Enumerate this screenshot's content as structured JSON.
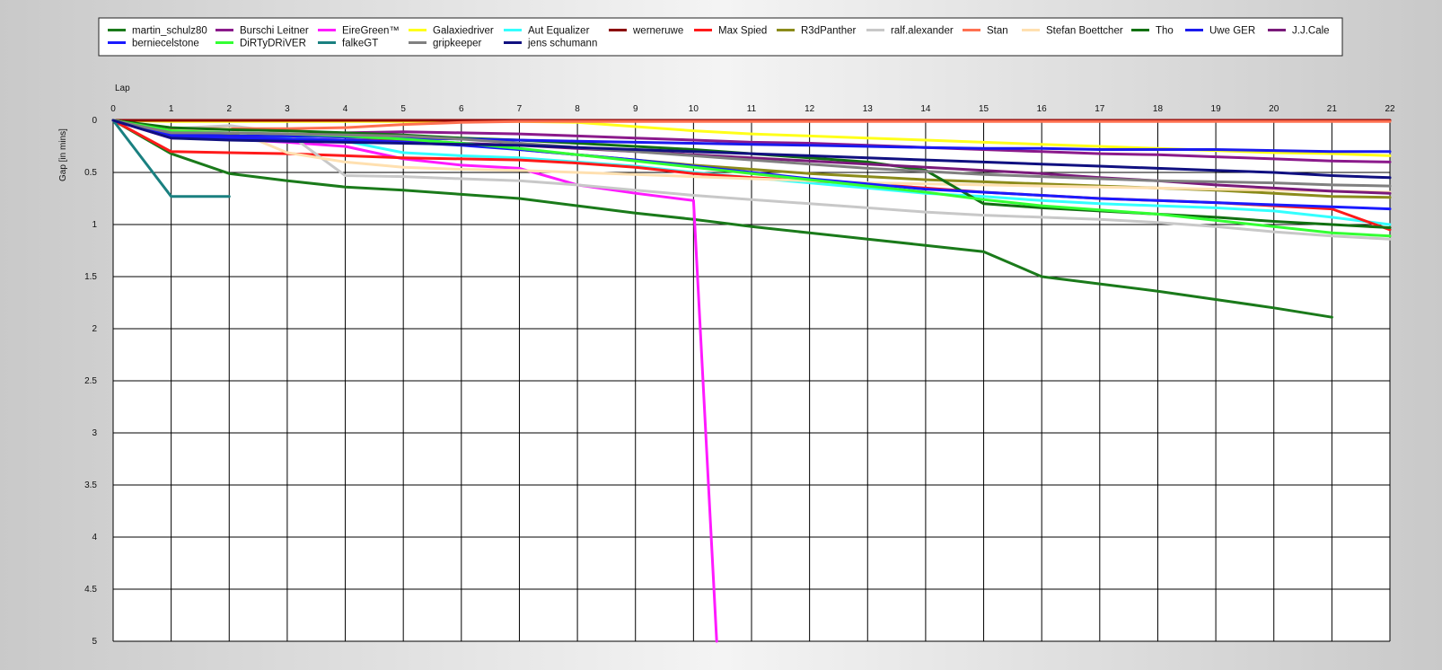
{
  "chart_data": {
    "type": "line",
    "title": "",
    "xlabel": "Lap",
    "ylabel": "Gap [in mins]",
    "xlim": [
      0,
      22
    ],
    "ylim": [
      0,
      5
    ],
    "y_inverted": true,
    "grid": true,
    "legend_position": "top",
    "x_ticks": [
      0,
      1,
      2,
      3,
      4,
      5,
      6,
      7,
      8,
      9,
      10,
      11,
      12,
      13,
      14,
      15,
      16,
      17,
      18,
      19,
      20,
      21,
      22
    ],
    "y_ticks": [
      0,
      0.5,
      1,
      1.5,
      2,
      2.5,
      3,
      3.5,
      4,
      4.5,
      5
    ],
    "series": [
      {
        "name": "martin_schulz80",
        "color": "#1a7a1a",
        "x": [
          0,
          1,
          2,
          3,
          4,
          5,
          6,
          7,
          8,
          9,
          10,
          11,
          12,
          13,
          14,
          15,
          16,
          17,
          18,
          19,
          20,
          21
        ],
        "y": [
          0,
          0.32,
          0.51,
          0.58,
          0.64,
          0.67,
          0.71,
          0.75,
          0.82,
          0.89,
          0.95,
          1.02,
          1.08,
          1.14,
          1.2,
          1.26,
          1.5,
          1.57,
          1.64,
          1.72,
          1.8,
          1.89
        ]
      },
      {
        "name": "Burschi Leitner",
        "color": "#8b1a8b",
        "x": [
          0,
          1,
          2,
          3,
          4,
          5,
          6,
          7,
          8,
          9,
          10,
          11,
          12,
          13,
          14,
          15,
          16,
          17,
          18,
          19,
          20,
          21,
          22
        ],
        "y": [
          0,
          0.15,
          0.15,
          0.14,
          0.12,
          0.11,
          0.12,
          0.13,
          0.15,
          0.17,
          0.19,
          0.21,
          0.22,
          0.24,
          0.26,
          0.28,
          0.3,
          0.32,
          0.33,
          0.35,
          0.37,
          0.39,
          0.4
        ]
      },
      {
        "name": "EireGreen™",
        "color": "#ff1aff",
        "x": [
          0,
          1,
          2,
          3,
          4,
          5,
          6,
          7,
          8,
          9,
          10,
          10.4
        ],
        "y": [
          0,
          0.17,
          0.18,
          0.21,
          0.25,
          0.37,
          0.43,
          0.46,
          0.62,
          0.7,
          0.77,
          5.0
        ]
      },
      {
        "name": "Galaxiedriver",
        "color": "#ffff1a",
        "x": [
          0,
          1,
          2,
          3,
          4,
          5,
          6,
          7,
          8,
          9,
          10,
          11,
          12,
          13,
          14,
          15,
          16,
          17,
          18,
          19,
          20,
          21,
          22
        ],
        "y": [
          0,
          0.01,
          0.01,
          0.01,
          0.01,
          0.01,
          0.01,
          0.01,
          0.02,
          0.06,
          0.1,
          0.13,
          0.15,
          0.17,
          0.19,
          0.21,
          0.23,
          0.25,
          0.27,
          0.29,
          0.31,
          0.32,
          0.34
        ]
      },
      {
        "name": "Aut Equalizer",
        "color": "#33ffff",
        "x": [
          0,
          1,
          2,
          3,
          4,
          5,
          6,
          7,
          8,
          9,
          10,
          11,
          12,
          13,
          14,
          15,
          16,
          17,
          18,
          19,
          20,
          21,
          22
        ],
        "y": [
          0,
          0.12,
          0.14,
          0.17,
          0.2,
          0.31,
          0.34,
          0.36,
          0.4,
          0.44,
          0.5,
          0.55,
          0.6,
          0.65,
          0.7,
          0.73,
          0.77,
          0.8,
          0.82,
          0.84,
          0.87,
          0.93,
          1.0
        ]
      },
      {
        "name": "werneruwe",
        "color": "#8b0000",
        "x": [
          0,
          1,
          2,
          3,
          4,
          5,
          6,
          7,
          8,
          9,
          10,
          11,
          12,
          13,
          14,
          15,
          16,
          17,
          18,
          19,
          20,
          21,
          22
        ],
        "y": [
          0,
          0,
          0,
          0,
          0,
          0,
          0,
          0,
          0,
          0,
          0,
          0,
          0,
          0,
          0,
          0,
          0,
          0,
          0,
          0,
          0,
          0,
          0
        ]
      },
      {
        "name": "Max Spied",
        "color": "#ff1a1a",
        "x": [
          0,
          1,
          2,
          3,
          4,
          5,
          6,
          7,
          8,
          9,
          10,
          11,
          12,
          13,
          14,
          15,
          16,
          17,
          18,
          19,
          20,
          21,
          22
        ],
        "y": [
          0,
          0.3,
          0.31,
          0.32,
          0.34,
          0.36,
          0.37,
          0.38,
          0.41,
          0.45,
          0.51,
          0.55,
          0.58,
          0.61,
          0.65,
          0.69,
          0.72,
          0.75,
          0.77,
          0.79,
          0.82,
          0.85,
          1.05
        ]
      },
      {
        "name": "R3dPanther",
        "color": "#8b8b1a",
        "x": [
          0,
          1,
          2,
          3,
          4,
          5,
          6,
          7,
          8,
          9,
          10,
          11,
          12,
          13,
          14,
          15,
          16,
          17,
          18,
          19,
          20,
          21,
          22
        ],
        "y": [
          0,
          0.11,
          0.13,
          0.14,
          0.16,
          0.18,
          0.22,
          0.28,
          0.33,
          0.38,
          0.43,
          0.47,
          0.51,
          0.54,
          0.57,
          0.59,
          0.61,
          0.63,
          0.65,
          0.67,
          0.7,
          0.73,
          0.74
        ]
      },
      {
        "name": "ralf.alexander",
        "color": "#c8c8c8",
        "x": [
          0,
          1,
          2,
          3,
          4,
          5,
          6,
          7,
          8,
          9,
          10,
          11,
          12,
          13,
          14,
          15,
          16,
          17,
          18,
          19,
          20,
          21,
          22
        ],
        "y": [
          0,
          0.08,
          0.05,
          0.12,
          0.53,
          0.54,
          0.56,
          0.58,
          0.62,
          0.67,
          0.72,
          0.76,
          0.8,
          0.84,
          0.88,
          0.91,
          0.93,
          0.95,
          0.98,
          1.02,
          1.07,
          1.11,
          1.14
        ]
      },
      {
        "name": "Stan",
        "color": "#ff7050",
        "x": [
          0,
          1,
          2,
          3,
          4,
          5,
          6,
          7,
          8,
          9,
          10,
          11,
          12,
          13,
          14,
          15,
          16,
          17,
          18,
          19,
          20,
          21,
          22
        ],
        "y": [
          0,
          0.08,
          0.08,
          0.08,
          0.07,
          0.04,
          0.02,
          0.01,
          0.01,
          0.01,
          0.01,
          0.01,
          0.01,
          0.01,
          0.01,
          0.01,
          0.01,
          0.01,
          0.01,
          0.01,
          0.01,
          0.01,
          0.01
        ]
      },
      {
        "name": "Stefan Boettcher",
        "color": "#ffe0b0",
        "x": [
          0,
          1,
          2,
          3,
          4,
          5,
          6,
          7,
          8,
          9,
          10,
          11,
          12,
          13,
          14,
          15,
          16,
          17,
          18,
          19,
          20,
          21,
          22
        ],
        "y": [
          0,
          0.1,
          0.08,
          0.31,
          0.4,
          0.45,
          0.47,
          0.48,
          0.5,
          0.52,
          0.54,
          0.56,
          0.58,
          0.6,
          0.61,
          0.62,
          0.63,
          0.64,
          0.65,
          0.66,
          0.67,
          0.68,
          0.69
        ]
      },
      {
        "name": "Tho",
        "color": "#117011",
        "x": [
          0,
          1,
          2,
          3,
          4,
          5,
          6,
          7,
          8,
          9,
          10,
          11,
          12,
          13,
          14,
          15,
          16,
          17,
          18,
          19,
          20,
          21,
          22
        ],
        "y": [
          0,
          0.07,
          0.09,
          0.1,
          0.12,
          0.14,
          0.17,
          0.19,
          0.22,
          0.25,
          0.28,
          0.32,
          0.36,
          0.4,
          0.48,
          0.8,
          0.84,
          0.87,
          0.9,
          0.93,
          0.97,
          1.0,
          1.03
        ]
      },
      {
        "name": "Uwe GER",
        "color": "#1a1aee",
        "x": [
          0,
          1,
          2,
          3,
          4,
          5,
          6,
          7,
          8,
          9,
          10,
          11,
          12,
          13,
          14,
          15,
          16,
          17,
          18,
          19,
          20,
          21,
          22
        ],
        "y": [
          0,
          0.13,
          0.15,
          0.15,
          0.16,
          0.17,
          0.18,
          0.19,
          0.2,
          0.21,
          0.22,
          0.23,
          0.24,
          0.25,
          0.26,
          0.27,
          0.27,
          0.28,
          0.28,
          0.28,
          0.29,
          0.3,
          0.3
        ]
      },
      {
        "name": "J.J.Cale",
        "color": "#7a1a7a",
        "x": [
          0,
          1,
          2,
          3,
          4,
          5,
          6,
          7,
          8,
          9,
          10,
          11,
          12,
          13,
          14,
          15,
          16,
          17,
          18,
          19,
          20,
          21,
          22
        ],
        "y": [
          0,
          0.16,
          0.17,
          0.18,
          0.19,
          0.2,
          0.22,
          0.24,
          0.27,
          0.3,
          0.33,
          0.36,
          0.39,
          0.42,
          0.45,
          0.48,
          0.51,
          0.55,
          0.58,
          0.62,
          0.65,
          0.68,
          0.7
        ]
      },
      {
        "name": "berniecelstone",
        "color": "#1a1aff",
        "x": [
          0,
          1,
          2,
          3,
          4,
          5,
          6,
          7,
          8,
          9,
          10,
          11,
          12,
          13,
          14,
          15,
          16,
          17,
          18,
          19,
          20,
          21,
          22
        ],
        "y": [
          0,
          0.15,
          0.17,
          0.18,
          0.19,
          0.21,
          0.24,
          0.28,
          0.33,
          0.38,
          0.44,
          0.5,
          0.56,
          0.61,
          0.66,
          0.69,
          0.72,
          0.75,
          0.77,
          0.79,
          0.81,
          0.83,
          0.85
        ]
      },
      {
        "name": "DiRTyDRiVER",
        "color": "#33ff33",
        "x": [
          0,
          1,
          2,
          3,
          4,
          5,
          6,
          7,
          8,
          9,
          10,
          11,
          12,
          13,
          14,
          15,
          16,
          17,
          18,
          19,
          20,
          21,
          22
        ],
        "y": [
          0,
          0.1,
          0.12,
          0.13,
          0.15,
          0.18,
          0.22,
          0.27,
          0.33,
          0.39,
          0.45,
          0.51,
          0.57,
          0.63,
          0.69,
          0.76,
          0.82,
          0.86,
          0.9,
          0.96,
          1.02,
          1.08,
          1.11
        ]
      },
      {
        "name": "falkeGT",
        "color": "#1a8080",
        "x": [
          0,
          1,
          2
        ],
        "y": [
          0,
          0.73,
          0.73
        ]
      },
      {
        "name": "gripkeeper",
        "color": "#808080",
        "x": [
          0,
          1,
          2,
          3,
          4,
          5,
          6,
          7,
          8,
          9,
          10,
          11,
          12,
          13,
          14,
          15,
          16,
          17,
          18,
          19,
          20,
          21,
          22
        ],
        "y": [
          0,
          0.12,
          0.12,
          0.13,
          0.14,
          0.15,
          0.18,
          0.22,
          0.26,
          0.3,
          0.34,
          0.38,
          0.42,
          0.46,
          0.49,
          0.52,
          0.54,
          0.56,
          0.58,
          0.59,
          0.6,
          0.62,
          0.63
        ]
      },
      {
        "name": "jens  schumann",
        "color": "#101080",
        "x": [
          0,
          1,
          2,
          3,
          4,
          5,
          6,
          7,
          8,
          9,
          10,
          11,
          12,
          13,
          14,
          15,
          16,
          17,
          18,
          19,
          20,
          21,
          22
        ],
        "y": [
          0,
          0.17,
          0.19,
          0.2,
          0.21,
          0.22,
          0.23,
          0.24,
          0.26,
          0.28,
          0.3,
          0.32,
          0.34,
          0.36,
          0.38,
          0.4,
          0.42,
          0.44,
          0.46,
          0.48,
          0.5,
          0.53,
          0.55
        ]
      }
    ]
  }
}
